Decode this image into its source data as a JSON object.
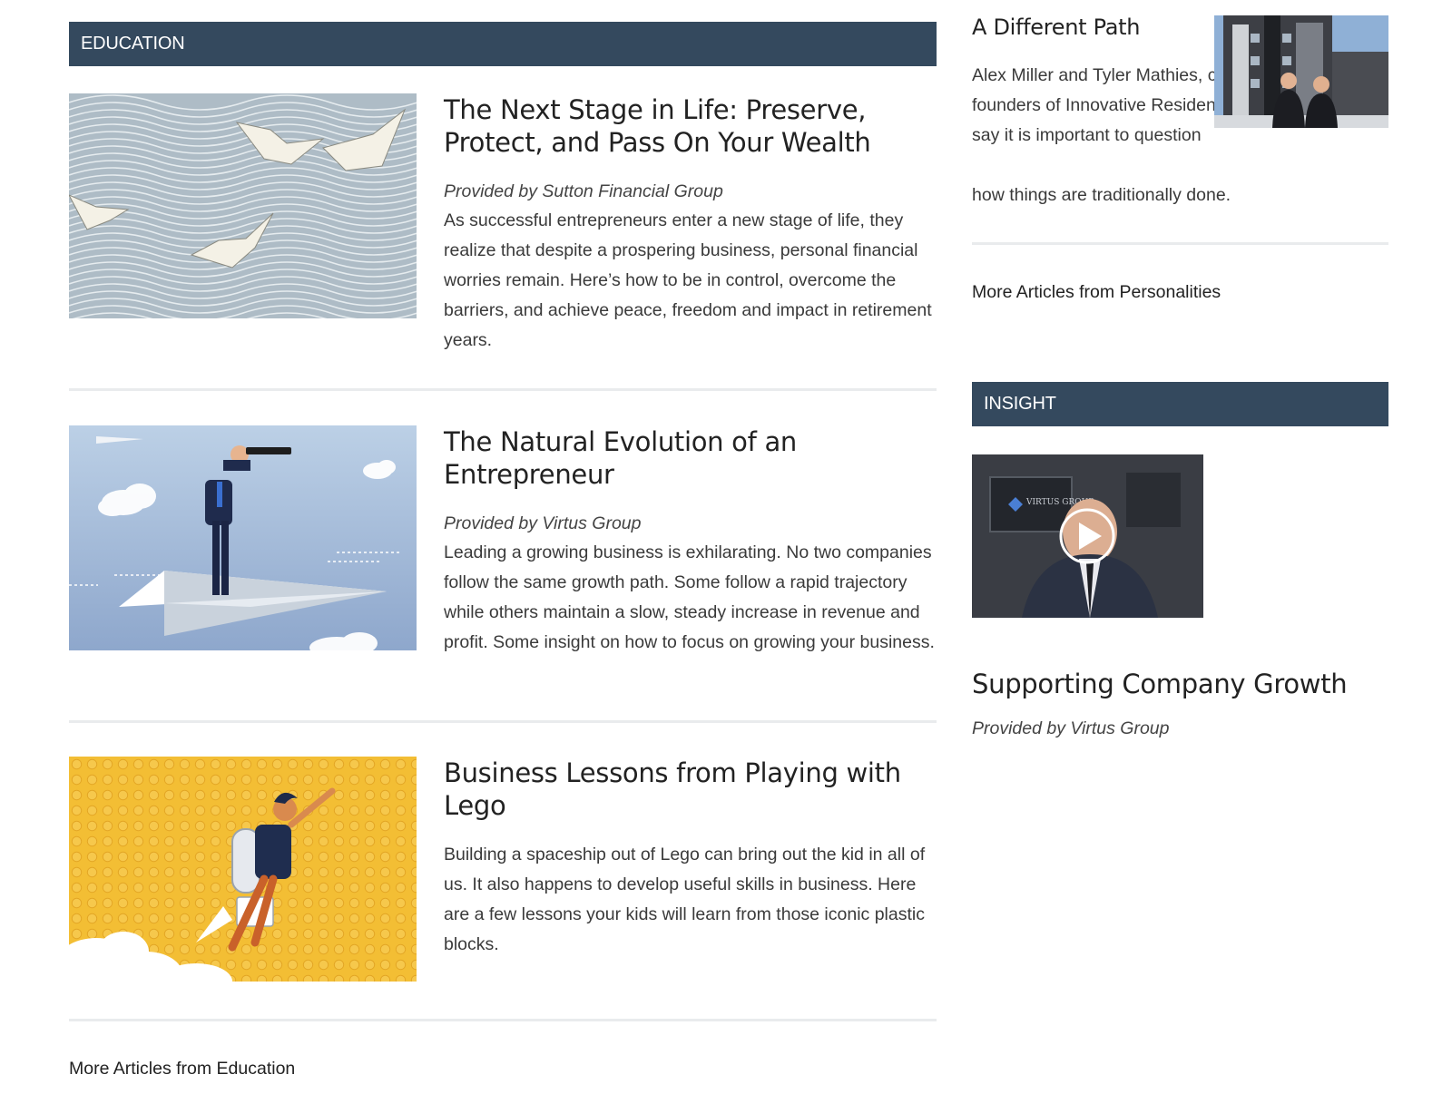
{
  "education": {
    "header": "EDUCATION",
    "articles": [
      {
        "title": "The Next Stage in Life: Preserve, Protect, and Pass On Your Wealth",
        "provider": "Provided by Sutton Financial Group",
        "excerpt": "As successful entrepreneurs enter a new stage of life, they realize that despite a prospering business, personal financial worries remain. Here’s how to be in control, overcome the barriers, and achieve peace, freedom and impact in retirement years."
      },
      {
        "title": "The Natural Evolution of an Entrepreneur",
        "provider": "Provided by Virtus Group",
        "excerpt": "Leading a growing business is exhilarating. No two companies follow the same growth path. Some follow a rapid trajectory while others maintain a slow, steady increase in revenue and profit. Some insight on how to focus on growing your business."
      },
      {
        "title": "Business Lessons from Playing with Lego",
        "provider": "",
        "excerpt": "Building a spaceship out of Lego can bring out the kid in all of us. It also happens to develop useful skills in business. Here are a few lessons your kids will learn from those iconic plastic blocks."
      }
    ],
    "more_link": "More Articles from Education"
  },
  "personalities": {
    "title": "A Different Path",
    "excerpt_wrapped": "Alex Miller and Tyler Mathies, co-founders of Innovative Residential, say it is important to question",
    "excerpt_tail": "how things are traditionally done.",
    "more_link": "More Articles from Personalities"
  },
  "insight": {
    "header": "INSIGHT",
    "video_logo_text": "VIRTUS GROUP",
    "title": "Supporting Company Growth",
    "provider": "Provided by Virtus Group"
  },
  "colors": {
    "header_bar": "#34495e",
    "divider": "#e9ebed",
    "wave_bg": "#a9b8c2",
    "sky_bg": "#a6bdd9",
    "lego_bg": "#f3be34"
  }
}
